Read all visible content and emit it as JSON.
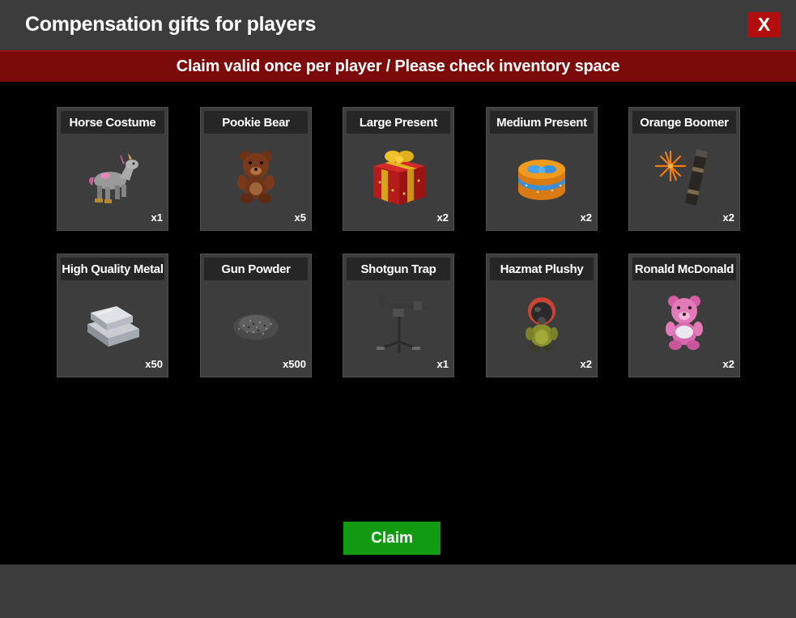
{
  "window": {
    "title": "Compensation gifts for players",
    "close_label": "X"
  },
  "notice": {
    "text": "Claim valid once per player / Please check inventory space"
  },
  "items": [
    {
      "name": "Horse Costume",
      "qty": "x1",
      "icon": "horse-costume-icon"
    },
    {
      "name": "Pookie Bear",
      "qty": "x5",
      "icon": "pookie-bear-icon"
    },
    {
      "name": "Large Present",
      "qty": "x2",
      "icon": "large-present-icon"
    },
    {
      "name": "Medium Present",
      "qty": "x2",
      "icon": "medium-present-icon"
    },
    {
      "name": "Orange Boomer",
      "qty": "x2",
      "icon": "orange-boomer-icon"
    },
    {
      "name": "High Quality Metal",
      "qty": "x50",
      "icon": "metal-ingot-icon"
    },
    {
      "name": "Gun Powder",
      "qty": "x500",
      "icon": "gun-powder-icon"
    },
    {
      "name": "Shotgun Trap",
      "qty": "x1",
      "icon": "shotgun-trap-icon"
    },
    {
      "name": "Hazmat Plushy",
      "qty": "x2",
      "icon": "hazmat-plushy-icon"
    },
    {
      "name": "Ronald McDonald",
      "qty": "x2",
      "icon": "pink-bear-icon"
    }
  ],
  "actions": {
    "claim_label": "Claim"
  },
  "colors": {
    "title_bar": "#3c3c3c",
    "notice_bar": "#7c0a0a",
    "close_button": "#b30e0e",
    "claim_button": "#139a13",
    "card": "#3d3d3d"
  }
}
